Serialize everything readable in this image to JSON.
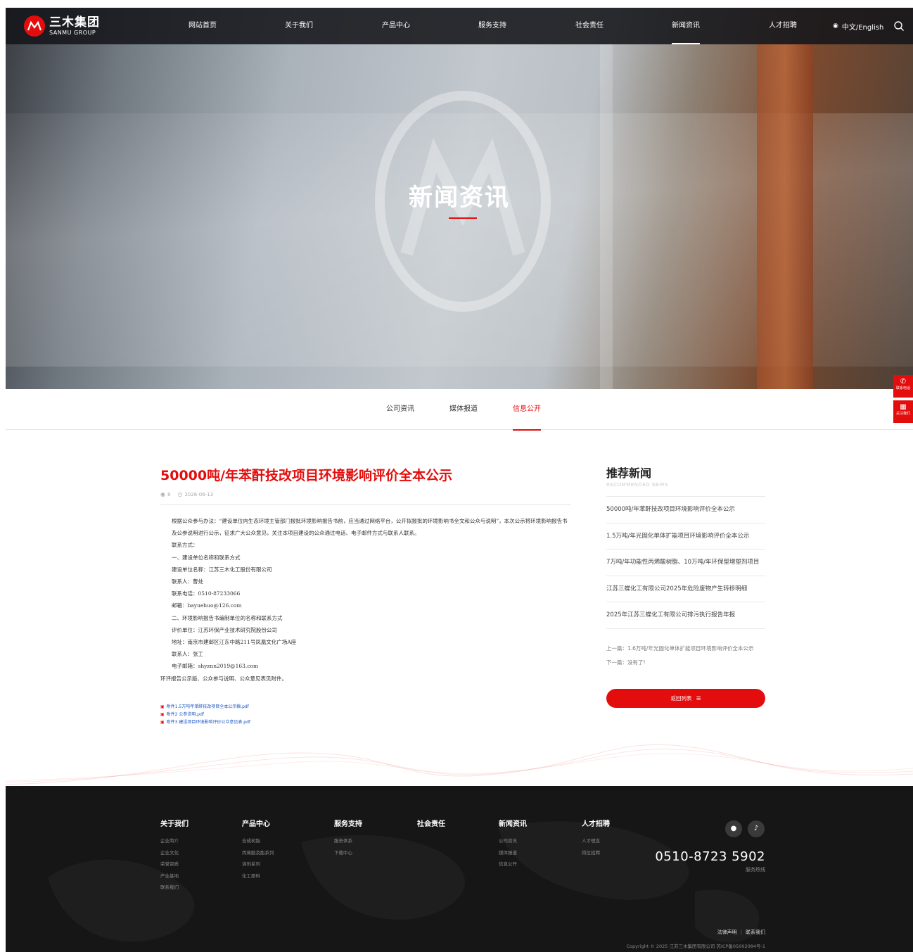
{
  "header": {
    "logo_cn": "三木集团",
    "logo_en": "SANMU GROUP",
    "nav": [
      {
        "label": "网站首页"
      },
      {
        "label": "关于我们"
      },
      {
        "label": "产品中心"
      },
      {
        "label": "服务支持"
      },
      {
        "label": "社会责任"
      },
      {
        "label": "新闻资讯"
      },
      {
        "label": "人才招聘"
      }
    ],
    "active_nav": "新闻资讯",
    "lang": "中文/English"
  },
  "hero": {
    "title": "新闻资讯"
  },
  "side_buttons": [
    {
      "label": "联系电话",
      "icon": "phone-icon"
    },
    {
      "label": "关注我们",
      "icon": "qrcode-icon"
    }
  ],
  "subtabs": [
    {
      "label": "公司资讯"
    },
    {
      "label": "媒体报道"
    },
    {
      "label": "信息公开"
    }
  ],
  "active_subtab": "信息公开",
  "article": {
    "title": "50000吨/年苯酐技改项目环境影响评价全本公示",
    "views": "8",
    "date": "2026-06-13",
    "paragraphs": [
      "根据公众参与办法：“建设单位向生态环境主管部门报批环境影响报告书前，应当通过网络平台，公开拟报批的环境影响书全文和公众与说明”，本次公示将环境影响报告书及公参说明进行公示，征求广大公众意见，关注本项目建设的公众通过电话、电子邮件方式与联系人联系。",
      "联系方式：",
      "一、建设单位名称和联系方式",
      "建设单位名称：江苏三木化工股份有限公司",
      "联系人：曹处",
      "联系电话：0510-87233066",
      "邮箱：bayuehuo@126.com",
      "二、环境影响报告书编制单位的名称和联系方式",
      "评价单位：江苏环保产业技术研究院股份公司",
      "地址：南京市建邺区江东中路211号凤凰文化广场A座",
      "联系人：张工",
      "电子邮箱：shyznn2019@163.com",
      "环评报告公示版、公众参与说明、公众意见表见附件。"
    ],
    "attachments": [
      "附件1.5万吨年苯酐技改项目全本公示稿.pdf",
      "附件2 公参说明.pdf",
      "附件3 建设项目环境影响评价公众意见表.pdf"
    ]
  },
  "sidebar": {
    "title": "推荐新闻",
    "subtitle": "RECOMMENDED NEWS",
    "items": [
      "50000吨/年苯酐技改项目环境影响评价全本公示",
      "1.5万吨/年光固化单体扩能项目环境影响评价全本公示",
      "7万吨/年功能性丙烯酸树脂、10万吨/年环保型增塑剂项目",
      "江苏三蝶化工有限公司2025年危险废物产生转移明细",
      "2025年江苏三蝶化工有限公司排污执行报告年报"
    ],
    "prev": "上一篇：1.6万吨/年光固化单体扩能项目环境影响评价全本公示",
    "next": "下一篇：没有了!",
    "back_label": "返回列表"
  },
  "footer": {
    "columns": [
      {
        "title": "关于我们",
        "links": [
          "企业简介",
          "企业文化",
          "荣誉资质",
          "产业基地",
          "联系我们"
        ]
      },
      {
        "title": "产品中心",
        "links": [
          "合成树脂",
          "丙烯酸及酯系列",
          "溶剂系列",
          "化工原料"
        ]
      },
      {
        "title": "服务支持",
        "links": [
          "服务体系",
          "下载中心"
        ]
      },
      {
        "title": "社会责任",
        "links": []
      },
      {
        "title": "新闻资讯",
        "links": [
          "公司资讯",
          "媒体报道",
          "信息公开"
        ]
      },
      {
        "title": "人才招聘",
        "links": [
          "人才理念",
          "岗位招聘"
        ]
      }
    ],
    "hotline": "0510-8723 5902",
    "hotline_label": "服务热线",
    "legal": "法律声明",
    "contact": "联系我们",
    "copyright": "Copyright © 2025 江苏三木集团有限公司 苏ICP备05002084号-1"
  },
  "colors": {
    "accent": "#e40d0d",
    "header_bg": "#14161a",
    "footer_bg": "#161616",
    "link": "#1a55c4"
  }
}
